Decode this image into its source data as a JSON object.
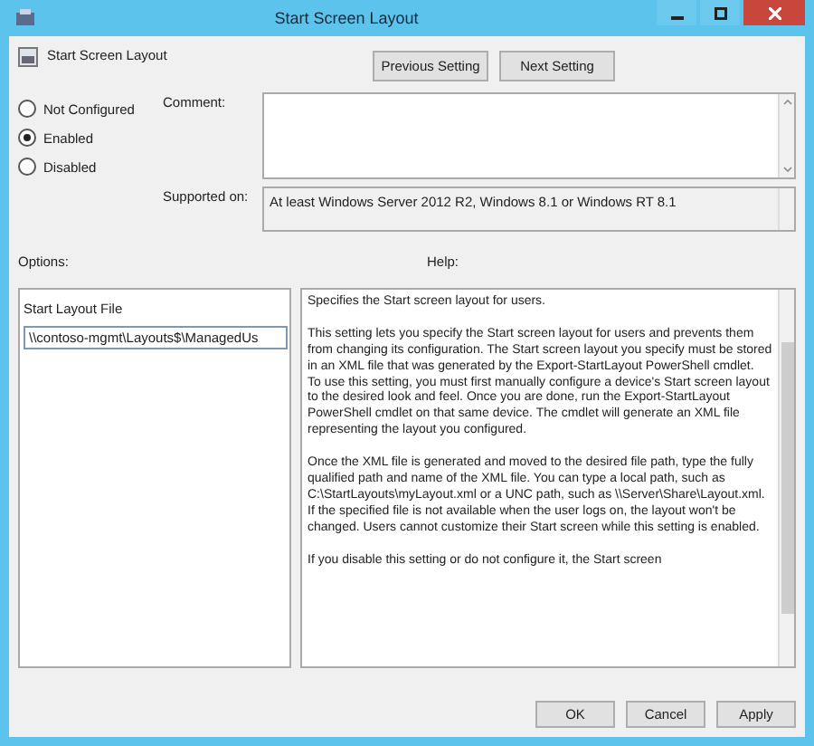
{
  "window": {
    "title": "Start Screen Layout"
  },
  "header": {
    "setting_name": "Start Screen Layout"
  },
  "nav_buttons": [
    "Previous Setting",
    "Next Setting"
  ],
  "state_options": [
    {
      "label": "Not Configured",
      "selected": false
    },
    {
      "label": "Enabled",
      "selected": true
    },
    {
      "label": "Disabled",
      "selected": false
    }
  ],
  "comment": {
    "label": "Comment:"
  },
  "supported_on": {
    "label": "Supported on:",
    "value": "At least Windows Server 2012 R2, Windows 8.1 or Windows RT 8.1"
  },
  "options": {
    "label": "Options:",
    "field_label": "Start Layout File",
    "field_value": "\\\\contoso-mgmt\\Layouts$\\ManagedUs"
  },
  "help": {
    "label": "Help:",
    "text": "Specifies the Start screen layout for users.\n\nThis setting lets you specify the Start screen layout for users and prevents them from changing its configuration. The Start screen layout you specify must be stored in an XML file that was generated by the Export-StartLayout PowerShell cmdlet.\nTo use this setting, you must first manually configure a device's Start screen layout to the desired look and feel. Once you are done, run the Export-StartLayout PowerShell cmdlet on that same device. The cmdlet will generate an XML file representing the layout you configured.\n\nOnce the XML file is generated and moved to the desired file path, type the fully qualified path and name of the XML file. You can type a local path, such as C:\\StartLayouts\\myLayout.xml or a UNC path, such as \\\\Server\\Share\\Layout.xml. If the specified file is not available when the user logs on, the layout won't be changed. Users cannot customize their Start screen while this setting is enabled.\n\nIf you disable this setting or do not configure it, the Start screen"
  },
  "footer_buttons": [
    "OK",
    "Cancel",
    "Apply"
  ]
}
